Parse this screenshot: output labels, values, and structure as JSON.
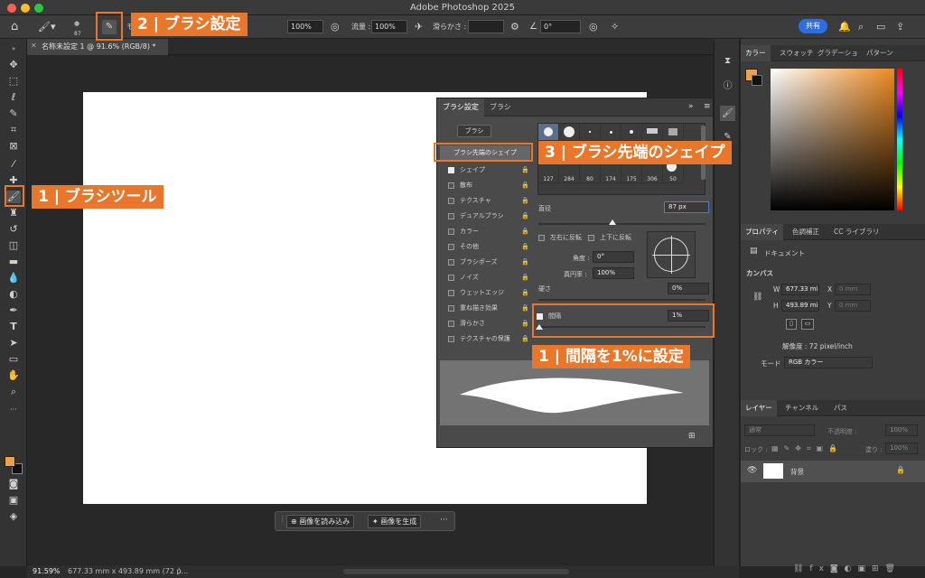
{
  "window": {
    "title": "Adobe Photoshop 2025"
  },
  "options": {
    "brush_size": "87",
    "mode_label": "モ",
    "opacity": "100%",
    "flow_label": "流量 :",
    "flow": "100%",
    "smooth_label": "滑らかさ :",
    "angle": "0°",
    "share": "共有"
  },
  "document": {
    "tab": "名称未設定 1 @ 91.6% (RGB/8) *"
  },
  "status": {
    "zoom": "91.59%",
    "size": "677.33 mm x 493.89 mm (72 p...",
    "chev": "〉"
  },
  "context": {
    "load": "画像を読み込み",
    "generate": "画像を生成",
    "more": "···"
  },
  "brush_panel": {
    "tab1": "ブラシ設定",
    "tab2": "ブラシ",
    "brushes_btn": "ブラシ",
    "selected": "ブラシ先端のシェイプ",
    "items": [
      {
        "label": "シェイプ",
        "on": true
      },
      {
        "label": "散布",
        "on": false
      },
      {
        "label": "テクスチャ",
        "on": false
      },
      {
        "label": "デュアルブラシ",
        "on": false
      },
      {
        "label": "カラー",
        "on": false
      },
      {
        "label": "その他",
        "on": false
      },
      {
        "label": "ブラシポーズ",
        "on": false
      },
      {
        "label": "ノイズ",
        "on": false
      },
      {
        "label": "ウェットエッジ",
        "on": false
      },
      {
        "label": "重ね描き効果",
        "on": false
      },
      {
        "label": "滑らかさ",
        "on": false
      },
      {
        "label": "テクスチャの保護",
        "on": false
      }
    ],
    "tips": [
      "127",
      "284",
      "80",
      "174",
      "175",
      "306",
      "50"
    ],
    "diameter_label": "直径",
    "diameter": "87 px",
    "flipx": "左右に反転",
    "flipy": "上下に反転",
    "angle_label": "角度 :",
    "angle": "0°",
    "roundness_label": "真円率 :",
    "roundness": "100%",
    "hardness_label": "硬さ",
    "hardness": "0%",
    "spacing_label": "間隔",
    "spacing": "1%"
  },
  "color_tabs": [
    "カラー",
    "スウォッチ",
    "グラデーショ",
    "パターン"
  ],
  "props": {
    "tabs": [
      "プロパティ",
      "色調補正",
      "CC ライブラリ"
    ],
    "doc": "ドキュメント",
    "canvas": "カンバス",
    "w_label": "W",
    "w": "677.33 mi",
    "h_label": "H",
    "h": "493.89 mi",
    "x_label": "X",
    "x": "0 mm",
    "y_label": "Y",
    "y": "0 mm",
    "res": "解像度 : 72 pixel/inch",
    "mode_label": "モード",
    "mode": "RGB カラー"
  },
  "layers": {
    "tabs": [
      "レイヤー",
      "チャンネル",
      "パス"
    ],
    "blend": "通常",
    "opacity_label": "不透明度 :",
    "opacity": "100%",
    "lock_label": "ロック :",
    "fill_label": "塗り :",
    "fill": "100%",
    "layer": "背景"
  },
  "callouts": {
    "c1": "1 | ブラシツール",
    "c2": "2 | ブラシ設定",
    "c3": "3 | ブラシ先端のシェイプ",
    "c4": "1 | 間隔を1%に設定"
  },
  "colors": {
    "accent": "#e8762b",
    "fg": "#f0a04b"
  }
}
